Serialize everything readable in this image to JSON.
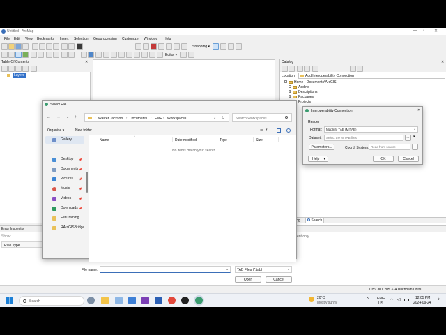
{
  "window": {
    "title": "Untitled - ArcMap"
  },
  "menu": [
    "File",
    "Edit",
    "View",
    "Bookmarks",
    "Insert",
    "Selection",
    "Geoprocessing",
    "Customize",
    "Windows",
    "Help"
  ],
  "toolbar": {
    "editor_label": "Editor ▾",
    "snapping_label": "Snapping ▾"
  },
  "toc": {
    "title": "Table Of Contents",
    "layers_label": "Layers"
  },
  "catalog": {
    "title": "Catalog",
    "location_label": "Location:",
    "location_value": "Add Interoperability Connection",
    "tree": [
      "Home - Documents\\ArcGIS",
      "AddIns",
      "Descriptions",
      "Packages",
      "Projects"
    ],
    "tab_search": "Search"
  },
  "error_inspector": {
    "title": "Error Inspector",
    "show_label": "Show:",
    "rule_type_header": "Rule Type",
    "right_text": "ent only"
  },
  "status_bar": {
    "coords": "1059.301  205.374 Unknown Units"
  },
  "select_file": {
    "title": "Select File",
    "breadcrumb": [
      "Walker Jackson",
      "Documents",
      "FME",
      "Workspaces"
    ],
    "search_placeholder": "Search Workspaces",
    "organise": "Organise ▾",
    "new_folder": "New folder",
    "columns": {
      "name": "Name",
      "date": "Date modified",
      "type": "Type",
      "size": "Size"
    },
    "empty_text": "No items match your search.",
    "sidebar": [
      "Gallery",
      "Desktop",
      "Documents",
      "Pictures",
      "Music",
      "Videos",
      "Downloads",
      "EsriTraining",
      "RArcGISBridge"
    ],
    "file_name_label": "File name:",
    "file_name_value": "",
    "file_type": "TAB Files (*.tab)",
    "open_button": "Open",
    "cancel_button": "Cancel"
  },
  "interop": {
    "title": "Interoperability Connection",
    "reader_label": "Reader",
    "format_label": "Format:",
    "format_value": "MapInfo TAB (MITAB)",
    "dataset_label": "Dataset:",
    "dataset_placeholder": "Select the MITAB files",
    "dataset_browse": "...",
    "parameters_button": "Parameters...",
    "coord_label": "Coord. System:",
    "coord_placeholder": "Read from source",
    "coord_browse": "...",
    "help_button": "Help",
    "ok_button": "OK",
    "cancel_button": "Cancel"
  },
  "taskbar": {
    "search_placeholder": "Search",
    "weather_temp": "20°C",
    "weather_text": "Mostly sunny",
    "lang": "ENG",
    "region": "US",
    "time": "12:05 PM",
    "date": "2024-09-24"
  }
}
